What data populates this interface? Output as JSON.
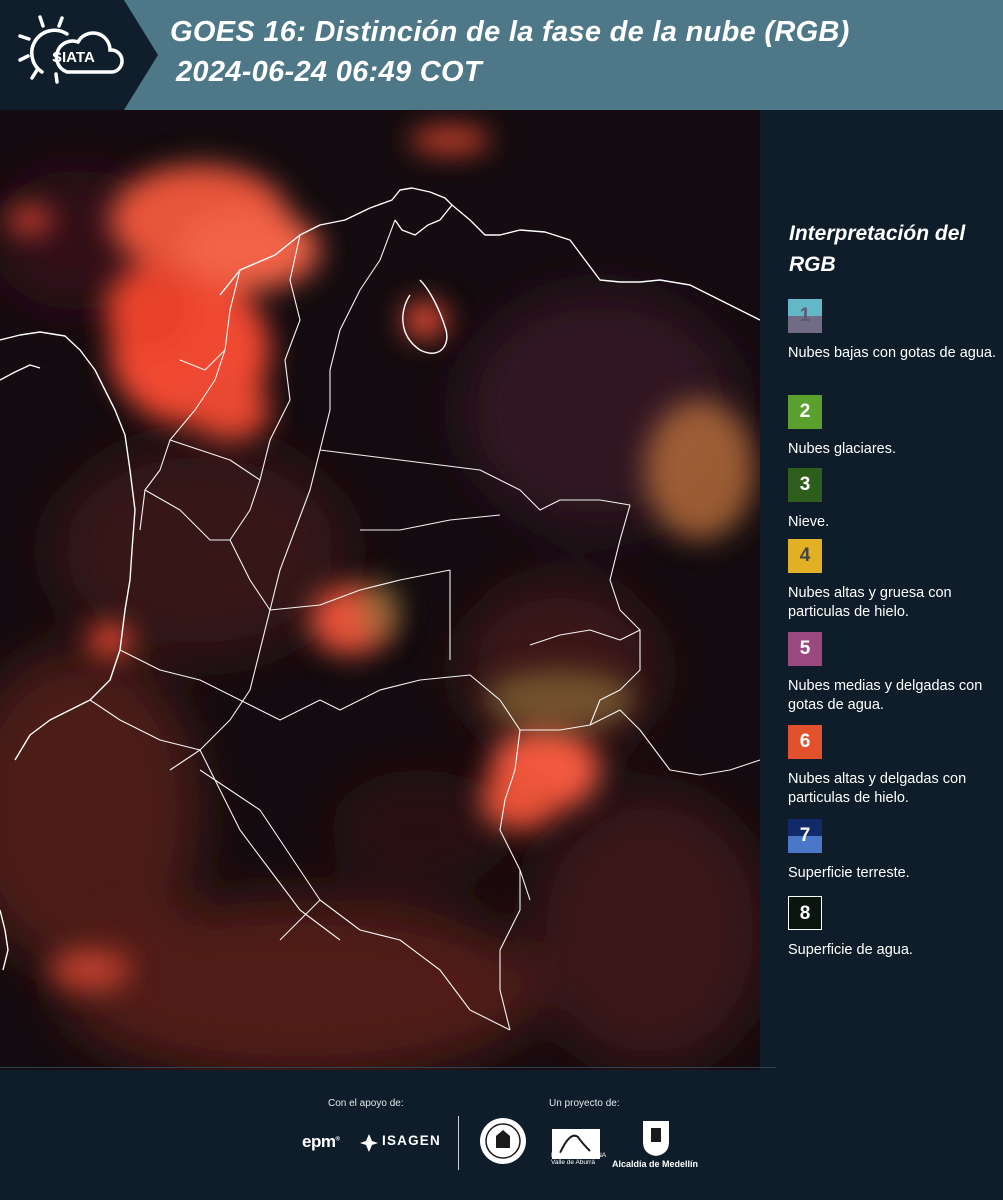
{
  "header": {
    "logo_text": "SIATA",
    "title_line1": "GOES 16: Distinción de la fase de la nube (RGB)",
    "title_line2": "2024-06-24 06:49 COT",
    "band_color": "#4e7888",
    "background_color": "#0f1e2a"
  },
  "legend": {
    "title": "Interpretación del RGB",
    "items": [
      {
        "number": "1",
        "label": "Nubes bajas con gotas de agua.",
        "color_top": "#62b8c7",
        "color_bottom": "#726b86",
        "text_color": "#5a5a70"
      },
      {
        "number": "2",
        "label": "Nubes glaciares.",
        "color_top": "#5aa02c",
        "color_bottom": "#5aa02c",
        "text_color": "#ffffff"
      },
      {
        "number": "3",
        "label": "Nieve.",
        "color_top": "#2d5e1c",
        "color_bottom": "#2d5e1c",
        "text_color": "#ffffff"
      },
      {
        "number": "4",
        "label": "Nubes altas y gruesa con particulas de hielo.",
        "color_top": "#e2b024",
        "color_bottom": "#e2b024",
        "text_color": "#444444"
      },
      {
        "number": "5",
        "label": "Nubes medias y delgadas con gotas de agua.",
        "color_top": "#9a4a80",
        "color_bottom": "#9a4a80",
        "text_color": "#ffffff"
      },
      {
        "number": "6",
        "label": "Nubes altas y delgadas con particulas de hielo.",
        "color_top": "#e2512c",
        "color_bottom": "#e2512c",
        "text_color": "#ffffff"
      },
      {
        "number": "7",
        "label": "Superficie terreste.",
        "color_top": "#132a6a",
        "color_bottom": "#4b77c8",
        "text_color": "#ffffff"
      },
      {
        "number": "8",
        "label": "Superficie de agua.",
        "color_top": "#0a1510",
        "color_bottom": "#0a1510",
        "text_color": "#ffffff"
      }
    ]
  },
  "footer": {
    "support_label": "Con el apoyo de:",
    "project_label": "Un proyecto de:",
    "epm": "epm",
    "isagen": "ISAGEN",
    "area_metropolitana": "METROPOLITANA Valle de Aburrá",
    "alcaldia": "Alcaldía de Medellín"
  }
}
